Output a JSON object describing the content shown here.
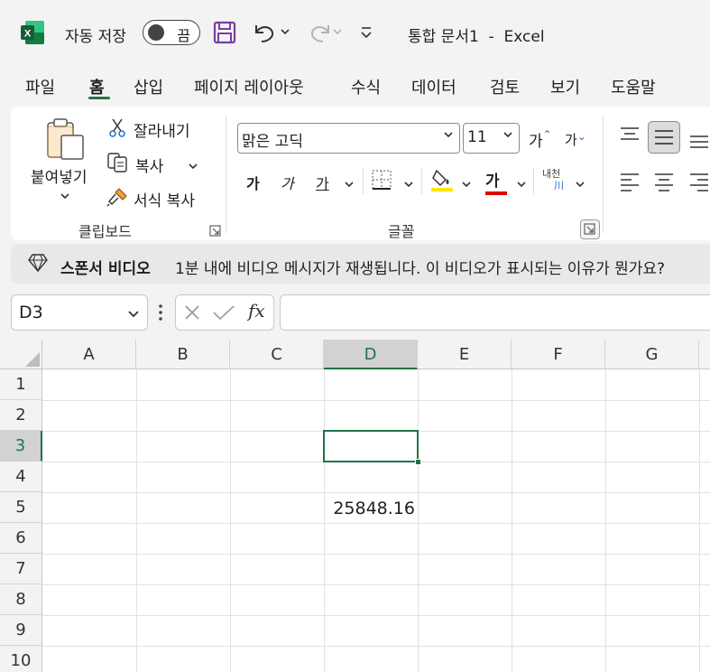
{
  "titlebar": {
    "autosave_label": "자동 저장",
    "toggle_state": "끔",
    "document_title": "통합 문서1  -  Excel",
    "icons": [
      "excel-logo-icon",
      "save-icon",
      "undo-icon",
      "redo-icon",
      "customize-qat-icon"
    ]
  },
  "menu": {
    "tabs": [
      {
        "label": "파일"
      },
      {
        "label": "홈",
        "active": true
      },
      {
        "label": "삽입"
      },
      {
        "label": "페이지 레이아웃"
      },
      {
        "label": "수식"
      },
      {
        "label": "데이터"
      },
      {
        "label": "검토"
      },
      {
        "label": "보기"
      },
      {
        "label": "도움말"
      }
    ]
  },
  "ribbon": {
    "clipboard": {
      "paste_label": "붙여넣기",
      "cut_label": "잘라내기",
      "copy_label": "복사",
      "format_painter_label": "서식 복사",
      "group_label": "클립보드"
    },
    "font": {
      "font_name": "맑은 고딕",
      "font_size": "11",
      "grow_label": "가",
      "shrink_label": "가",
      "bold_label": "가",
      "italic_label": "가",
      "underline_label": "가",
      "font_color_label": "가",
      "phonetic_top": "내천",
      "phonetic_bottom": "川",
      "group_label": "글꼴"
    }
  },
  "sponsor": {
    "title": "스폰서 비디오",
    "message": "1분 내에 비디오 메시지가 재생됩니다. 이 비디오가 표시되는 이유가 뭔가요?"
  },
  "formula_bar": {
    "name_box": "D3",
    "formula": ""
  },
  "sheet": {
    "columns": [
      "A",
      "B",
      "C",
      "D",
      "E",
      "F",
      "G"
    ],
    "rows": [
      "1",
      "2",
      "3",
      "4",
      "5",
      "6",
      "7",
      "8",
      "9",
      "10"
    ],
    "selected_cell": "D3",
    "cells": {
      "D5": "25848.16"
    }
  },
  "colors": {
    "accent": "#217346",
    "excel_green": "#107c41",
    "save_purple": "#7a3fa1"
  }
}
